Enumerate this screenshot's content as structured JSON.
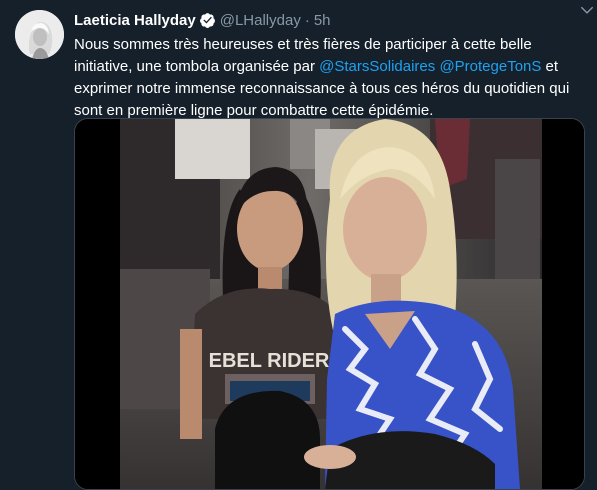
{
  "tweet": {
    "display_name": "Laeticia Hallyday",
    "handle": "@LHallyday",
    "separator": "·",
    "time": "5h",
    "text_part1": "Nous sommes très heureuses et très fières de participer à cette belle initiative, une tombola organisée par ",
    "mention1": "@StarsSolidaires",
    "mention2": "@ProtegeTonS",
    "text_part2": " et exprimer notre immense reconnaissance à tous ces héros du quotidien qui sont en première ligne pour combattre cette épidémie.",
    "shirt_print": "EBEL RIDER"
  },
  "colors": {
    "background": "#15202b",
    "secondary_text": "#8899a6",
    "link": "#1da1f2",
    "verified_badge": "#ffffff"
  },
  "icons": {
    "verified": "verified-badge-icon",
    "more": "chevron-down-icon"
  }
}
